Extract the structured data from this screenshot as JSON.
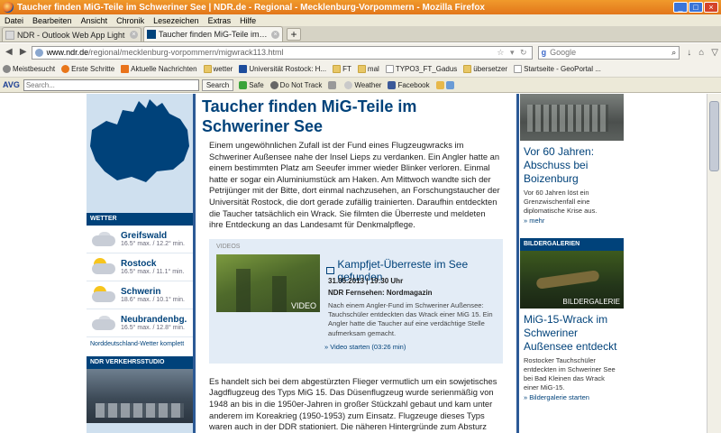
{
  "window": {
    "title": "Taucher finden MiG-Teile im Schweriner See | NDR.de - Regional - Mecklenburg-Vorpommern - Mozilla Firefox"
  },
  "menu": [
    "Datei",
    "Bearbeiten",
    "Ansicht",
    "Chronik",
    "Lesezeichen",
    "Extras",
    "Hilfe"
  ],
  "tabs": [
    {
      "label": "NDR - Outlook Web App Light",
      "active": false
    },
    {
      "label": "Taucher finden MiG-Teile im Schweriner S...",
      "active": true
    }
  ],
  "address": {
    "host": "www.ndr.de",
    "path": "/regional/mecklenburg-vorpommern/migwrack113.html"
  },
  "search": {
    "engine": "Google",
    "placeholder": "Google"
  },
  "bookmarks": [
    {
      "label": "Meistbesucht",
      "icon": "gear"
    },
    {
      "label": "Erste Schritte",
      "icon": "ff"
    },
    {
      "label": "Aktuelle Nachrichten",
      "icon": "rss"
    },
    {
      "label": "wetter",
      "icon": "folder"
    },
    {
      "label": "Universität Rostock: H...",
      "icon": "uni"
    },
    {
      "label": "FT",
      "icon": "folder"
    },
    {
      "label": "mal",
      "icon": "folder"
    },
    {
      "label": "TYPO3_FT_Gadus",
      "icon": "doc"
    },
    {
      "label": "übersetzer",
      "icon": "folder"
    },
    {
      "label": "Startseite - GeoPortal ...",
      "icon": "doc"
    }
  ],
  "avg": {
    "logo": "AVG",
    "search_placeholder": "Search...",
    "search_button": "Search",
    "items": [
      "Safe",
      "Do Not Track",
      "Weather",
      "Facebook"
    ]
  },
  "sidebar": {
    "weather_header": "WETTER",
    "weather": [
      {
        "city": "Greifswald",
        "temp": "16.5° max. / 12.2° min.",
        "icon": "cloud"
      },
      {
        "city": "Rostock",
        "temp": "16.5° max. / 11.1° min.",
        "icon": "sun-cloud"
      },
      {
        "city": "Schwerin",
        "temp": "18.6° max. / 10.1° min.",
        "icon": "sun-cloud"
      },
      {
        "city": "Neubrandenbg.",
        "temp": "16.5° max. / 12.8° min.",
        "icon": "cloud"
      }
    ],
    "weather_link": "Norddeutschland-Wetter komplett",
    "traffic_header": "NDR VERKEHRSSTUDIO"
  },
  "article": {
    "headline": "Taucher finden MiG-Teile im Schweriner See",
    "lead": "Einem ungewöhnlichen Zufall ist der Fund eines Flugzeugwracks im Schweriner Außensee nahe der Insel Lieps zu verdanken. Ein Angler hatte an einem bestimmten Platz am Seeufer immer wieder Blinker verloren. Einmal hatte er sogar ein Aluminiumstück am Haken. Am Mittwoch wandte sich der Petrijünger mit der Bitte, dort einmal nachzusehen, an Forschungstaucher der Universität Rostock, die dort gerade zufällig trainierten. Daraufhin entdeckten die Taucher tatsächlich ein Wrack. Sie filmten die Überreste und meldeten ihre Entdeckung an das Landesamt für Denkmalpflege.",
    "video": {
      "section_label": "VIDEOS",
      "thumb_label": "VIDEO",
      "title": "Kampfjet-Überreste im See gefunden",
      "date": "31.05.2013 | 19:30 Uhr",
      "source": "NDR Fernsehen: Nordmagazin",
      "description": "Nach einem Angler-Fund im Schweriner Außensee: Tauchschüler entdeckten das Wrack einer MiG 15. Ein Angler hatte die Taucher auf eine verdächtige Stelle aufmerksam gemacht.",
      "link": "» Video starten (03:26 min)"
    },
    "body": "Es handelt sich bei dem abgestürzten Flieger vermutlich um ein sowjetisches Jagdflugzeug des Typs MiG 15. Das Düsenflugzeug wurde serienmäßig von 1948 an bis in die 1950er-Jahren in großer Stückzahl gebaut und kam unter anderem im Koreakrieg (1950-1953) zum Einsatz. Flugzeuge dieses Typs waren auch in der DDR stationiert. Die näheren Hintergründe zum Absturz sind noch völlig offen."
  },
  "rightcol": {
    "teaser1": {
      "headline": "Vor 60 Jahren: Abschuss bei Boizenburg",
      "text": "Vor 60 Jahren löst ein Grenzwischenfall eine diplomatische Krise aus.",
      "link": "» mehr"
    },
    "gallery_header": "BILDERGALERIEN",
    "gallery_label": "BILDERGALERIE",
    "teaser2": {
      "headline": "MiG-15-Wrack im Schweriner Außensee entdeckt",
      "text": "Rostocker Tauchschüler entdeckten im Schweriner See bei Bad Kleinen das Wrack einer MiG-15.",
      "link": "» Bildergalerie starten"
    }
  },
  "colors": {
    "ndr_blue": "#00427a",
    "firefox_orange": "#e2761a"
  }
}
